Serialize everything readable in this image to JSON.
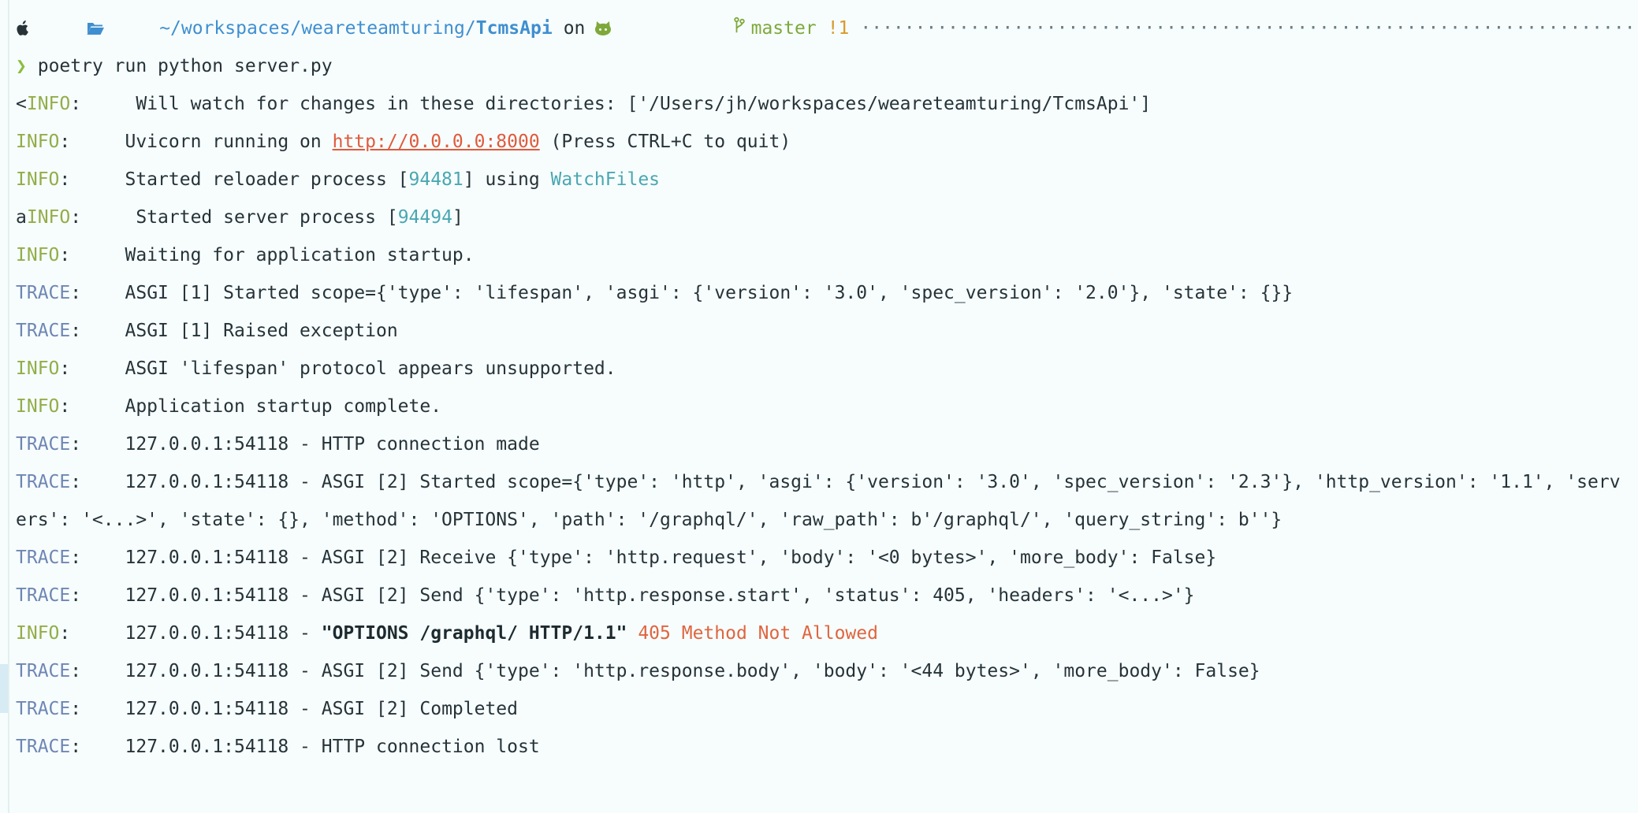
{
  "prompt": {
    "path_prefix": "~/workspaces/weareteamturing/",
    "path_current": "TcmsApi",
    "on_text": "on",
    "branch": "master",
    "git_status": "!1",
    "separator_dots": "··················································································································································",
    "prompt_char": "❯",
    "command": "poetry run python server.py"
  },
  "log": [
    {
      "prefix": "<",
      "level": "INFO",
      "sep": ":     ",
      "msg": "Will watch for changes in these directories: ['/Users/jh/workspaces/weareteamturing/TcmsApi']"
    },
    {
      "level": "INFO",
      "sep": ":     ",
      "msg_a": "Uvicorn running on ",
      "url": "http://0.0.0.0:8000",
      "msg_b": " (Press CTRL+C to quit)"
    },
    {
      "level": "INFO",
      "sep": ":     ",
      "msg_a": "Started reloader process [",
      "pid": "94481",
      "msg_b": "] using ",
      "tool": "WatchFiles"
    },
    {
      "prefix": "a",
      "level": "INFO",
      "sep": ":     ",
      "msg_a": "Started server process [",
      "pid": "94494",
      "msg_b": "]"
    },
    {
      "level": "INFO",
      "sep": ":     ",
      "msg": "Waiting for application startup."
    },
    {
      "level": "TRACE",
      "sep": ":    ",
      "msg": "ASGI [1] Started scope={'type': 'lifespan', 'asgi': {'version': '3.0', 'spec_version': '2.0'}, 'state': {}}"
    },
    {
      "level": "TRACE",
      "sep": ":    ",
      "msg": "ASGI [1] Raised exception"
    },
    {
      "level": "INFO",
      "sep": ":     ",
      "msg": "ASGI 'lifespan' protocol appears unsupported."
    },
    {
      "level": "INFO",
      "sep": ":     ",
      "msg": "Application startup complete."
    },
    {
      "level": "TRACE",
      "sep": ":    ",
      "msg": "127.0.0.1:54118 - HTTP connection made"
    },
    {
      "level": "TRACE",
      "sep": ":    ",
      "msg": "127.0.0.1:54118 - ASGI [2] Started scope={'type': 'http', 'asgi': {'version': '3.0', 'spec_version': '2.3'}, 'http_version': '1.1', 'serv"
    },
    {
      "continuation": "ers': '<...>', 'state': {}, 'method': 'OPTIONS', 'path': '/graphql/', 'raw_path': b'/graphql/', 'query_string': b''}"
    },
    {
      "level": "TRACE",
      "sep": ":    ",
      "msg": "127.0.0.1:54118 - ASGI [2] Receive {'type': 'http.request', 'body': '<0 bytes>', 'more_body': False}"
    },
    {
      "level": "TRACE",
      "sep": ":    ",
      "msg": "127.0.0.1:54118 - ASGI [2] Send {'type': 'http.response.start', 'status': 405, 'headers': '<...>'}"
    },
    {
      "level": "INFO",
      "sep": ":     ",
      "msg_a": "127.0.0.1:54118 - ",
      "request": "\"OPTIONS /graphql/ HTTP/1.1\"",
      "status_text": "405 Method Not Allowed"
    },
    {
      "level": "TRACE",
      "sep": ":    ",
      "msg": "127.0.0.1:54118 - ASGI [2] Send {'type': 'http.response.body', 'body': '<44 bytes>', 'more_body': False}"
    },
    {
      "level": "TRACE",
      "sep": ":    ",
      "msg": "127.0.0.1:54118 - ASGI [2] Completed"
    },
    {
      "level": "TRACE",
      "sep": ":    ",
      "msg": "127.0.0.1:54118 - HTTP connection lost"
    }
  ],
  "colors": {
    "background": "#f7fdfd",
    "info": "#93ad49",
    "trace": "#6f86b4",
    "path": "#3f8fd0",
    "branch": "#7ea93a",
    "git_status": "#d89a2a",
    "url": "#e05a3c",
    "error": "#e0653f",
    "number": "#4aa7b2"
  },
  "icons": [
    "apple-icon",
    "folder-icon",
    "github-icon",
    "git-branch-icon"
  ]
}
